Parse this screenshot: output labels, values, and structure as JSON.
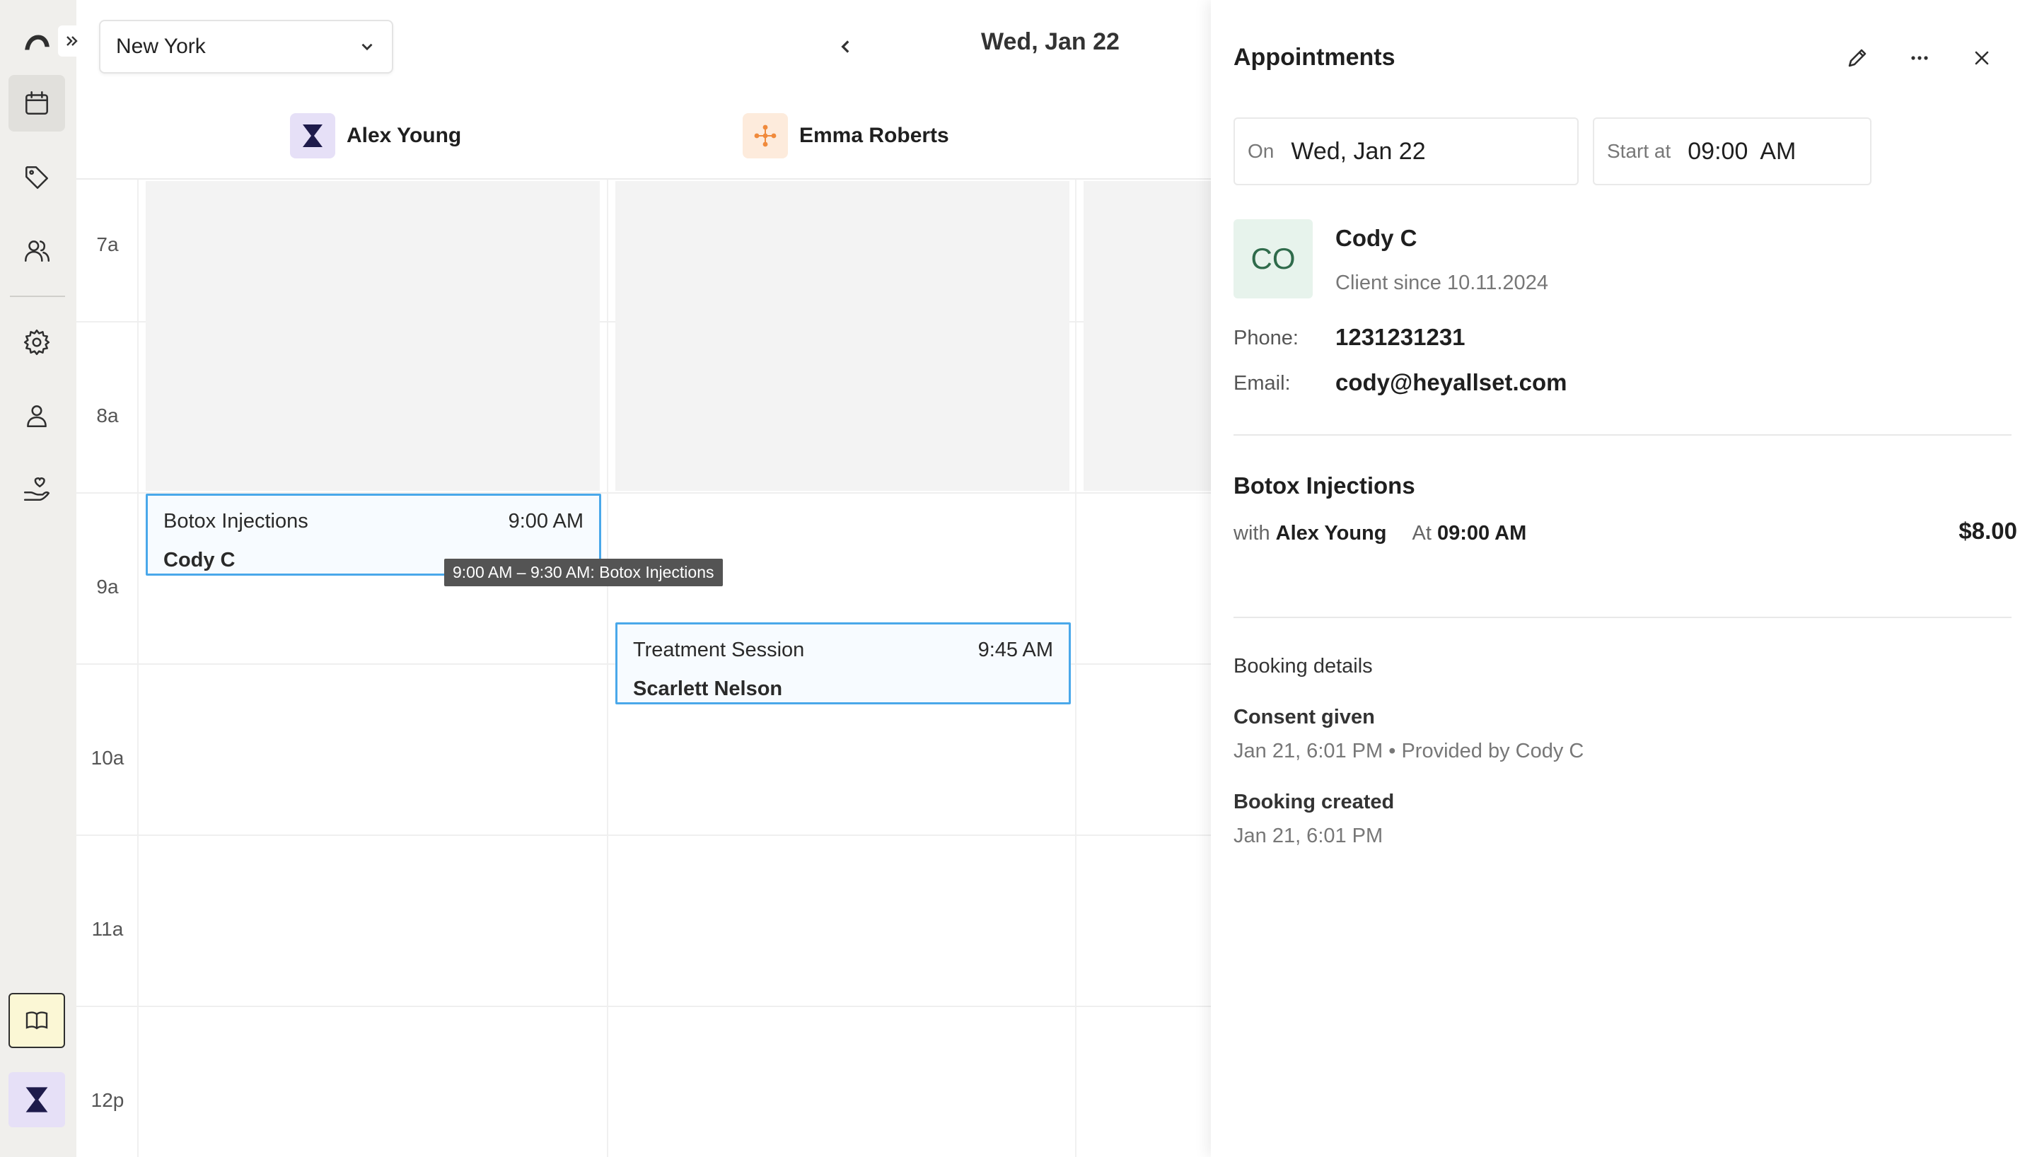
{
  "sidebar": {
    "items": [
      {
        "icon": "calendar-icon",
        "active": true
      },
      {
        "icon": "tag-icon"
      },
      {
        "icon": "users-icon"
      },
      {
        "icon": "gear-icon"
      },
      {
        "icon": "user-icon"
      },
      {
        "icon": "hand-heart-icon"
      }
    ]
  },
  "toolbar": {
    "location": "New York",
    "date": "Wed, Jan 22"
  },
  "staff": [
    {
      "name": "Alex Young",
      "avatar_color": "#e6e0f7"
    },
    {
      "name": "Emma Roberts",
      "avatar_color": "#fdebdc"
    }
  ],
  "time_labels": [
    "7a",
    "8a",
    "9a",
    "10a",
    "11a",
    "12p"
  ],
  "appointments": [
    {
      "service": "Botox Injections",
      "time": "9:00 AM",
      "client": "Cody C",
      "staff": "Alex Young"
    },
    {
      "service": "Treatment Session",
      "time": "9:45 AM",
      "client": "Scarlett Nelson",
      "staff": "Emma Roberts"
    }
  ],
  "tooltip": "9:00 AM – 9:30 AM: Botox Injections",
  "panel": {
    "title": "Appointments",
    "on_label": "On",
    "on_value": "Wed, Jan 22",
    "start_label": "Start at",
    "start_value": "09:00  AM",
    "client": {
      "initials": "CO",
      "name": "Cody C",
      "since": "Client since 10.11.2024",
      "phone_label": "Phone:",
      "phone": "1231231231",
      "email_label": "Email:",
      "email": "cody@heyallset.com"
    },
    "service": {
      "name": "Botox Injections",
      "with_label": "with",
      "staff": "Alex Young",
      "at_label": "At",
      "time": "09:00 AM",
      "price": "$8.00"
    },
    "booking": {
      "title": "Booking details",
      "consent_title": "Consent given",
      "consent_sub": "Jan 21, 6:01 PM • Provided by Cody C",
      "created_title": "Booking created",
      "created_sub": "Jan 21, 6:01 PM"
    }
  },
  "colors": {
    "accent": "#4aa8ea",
    "sidebar_bg": "#f0efec",
    "brand": "#1e1b4b"
  }
}
